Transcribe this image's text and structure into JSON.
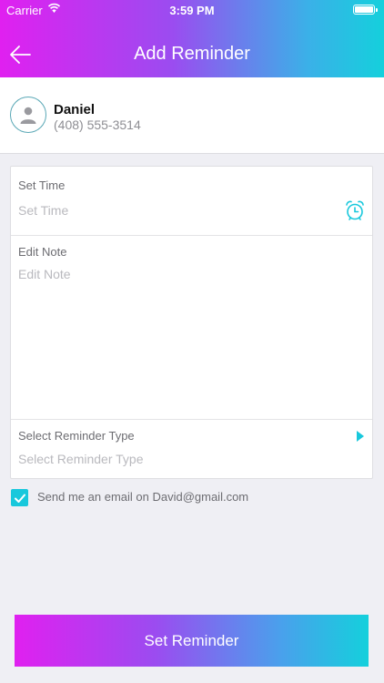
{
  "status_bar": {
    "carrier": "Carrier",
    "time": "3:59 PM"
  },
  "header": {
    "title": "Add Reminder",
    "back_icon": "back-arrow-icon"
  },
  "contact": {
    "name": "Daniel",
    "phone": "(408) 555-3514",
    "avatar_icon": "person-icon"
  },
  "form": {
    "time": {
      "label": "Set Time",
      "placeholder": "Set Time",
      "icon": "alarm-clock-icon"
    },
    "note": {
      "label": "Edit Note",
      "placeholder": "Edit Note"
    },
    "type": {
      "label": "Select Reminder Type",
      "placeholder": "Select Reminder Type",
      "icon": "disclosure-arrow-icon"
    }
  },
  "email_option": {
    "checked": true,
    "label": "Send me an email on David@gmail.com"
  },
  "submit": {
    "label": "Set Reminder"
  },
  "colors": {
    "gradient_start": "#e020f0",
    "gradient_end": "#14d0dc",
    "accent": "#18c8dc",
    "background": "#efeff4"
  }
}
